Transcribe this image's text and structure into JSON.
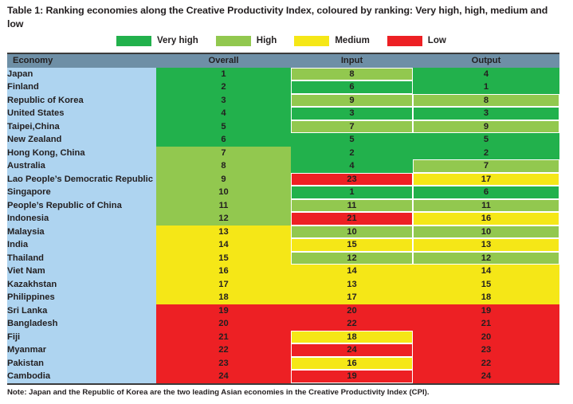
{
  "title": "Table 1: Ranking economies along the Creative Productivity Index, coloured by ranking: Very high, high, medium and low",
  "note": "Note: Japan and the Republic of Korea are the two leading Asian economies in the Creative Productivity Index (CPI).",
  "colors": {
    "very_high": "#22b14c",
    "high": "#92c84f",
    "medium": "#f5e717",
    "low": "#ed2024",
    "header_bg": "#6e8fa6",
    "economy_bg": "#aed4f0",
    "rule": "#3b3b3b",
    "text": "#231f20"
  },
  "legend": {
    "items": [
      {
        "label": "Very high",
        "tier": "very_high"
      },
      {
        "label": "High",
        "tier": "high"
      },
      {
        "label": "Medium",
        "tier": "medium"
      },
      {
        "label": "Low",
        "tier": "low"
      }
    ]
  },
  "table": {
    "columns": [
      {
        "key": "economy",
        "label": "Economy",
        "align": "left"
      },
      {
        "key": "overall",
        "label": "Overall",
        "align": "center"
      },
      {
        "key": "input",
        "label": "Input",
        "align": "center"
      },
      {
        "key": "output",
        "label": "Output",
        "align": "center"
      }
    ],
    "rows": [
      {
        "economy": "Japan",
        "overall": 1,
        "overall_tier": "very_high",
        "input": 8,
        "input_tier": "high",
        "output": 4,
        "output_tier": "very_high"
      },
      {
        "economy": "Finland",
        "overall": 2,
        "overall_tier": "very_high",
        "input": 6,
        "input_tier": "very_high",
        "output": 1,
        "output_tier": "very_high"
      },
      {
        "economy": "Republic of Korea",
        "overall": 3,
        "overall_tier": "very_high",
        "input": 9,
        "input_tier": "high",
        "output": 8,
        "output_tier": "high"
      },
      {
        "economy": "United States",
        "overall": 4,
        "overall_tier": "very_high",
        "input": 3,
        "input_tier": "very_high",
        "output": 3,
        "output_tier": "very_high"
      },
      {
        "economy": "Taipei,China",
        "overall": 5,
        "overall_tier": "very_high",
        "input": 7,
        "input_tier": "high",
        "output": 9,
        "output_tier": "high"
      },
      {
        "economy": "New Zealand",
        "overall": 6,
        "overall_tier": "very_high",
        "input": 5,
        "input_tier": "very_high",
        "output": 5,
        "output_tier": "very_high"
      },
      {
        "economy": "Hong Kong, China",
        "overall": 7,
        "overall_tier": "high",
        "input": 2,
        "input_tier": "very_high",
        "output": 2,
        "output_tier": "very_high"
      },
      {
        "economy": "Australia",
        "overall": 8,
        "overall_tier": "high",
        "input": 4,
        "input_tier": "very_high",
        "output": 7,
        "output_tier": "high"
      },
      {
        "economy": "Lao People’s Democratic Republic",
        "overall": 9,
        "overall_tier": "high",
        "input": 23,
        "input_tier": "low",
        "output": 17,
        "output_tier": "medium"
      },
      {
        "economy": "Singapore",
        "overall": 10,
        "overall_tier": "high",
        "input": 1,
        "input_tier": "very_high",
        "output": 6,
        "output_tier": "very_high"
      },
      {
        "economy": "People’s Republic of China",
        "overall": 11,
        "overall_tier": "high",
        "input": 11,
        "input_tier": "high",
        "output": 11,
        "output_tier": "high"
      },
      {
        "economy": "Indonesia",
        "overall": 12,
        "overall_tier": "high",
        "input": 21,
        "input_tier": "low",
        "output": 16,
        "output_tier": "medium"
      },
      {
        "economy": "Malaysia",
        "overall": 13,
        "overall_tier": "medium",
        "input": 10,
        "input_tier": "high",
        "output": 10,
        "output_tier": "high"
      },
      {
        "economy": "India",
        "overall": 14,
        "overall_tier": "medium",
        "input": 15,
        "input_tier": "medium",
        "output": 13,
        "output_tier": "medium"
      },
      {
        "economy": "Thailand",
        "overall": 15,
        "overall_tier": "medium",
        "input": 12,
        "input_tier": "high",
        "output": 12,
        "output_tier": "high"
      },
      {
        "economy": "Viet Nam",
        "overall": 16,
        "overall_tier": "medium",
        "input": 14,
        "input_tier": "medium",
        "output": 14,
        "output_tier": "medium"
      },
      {
        "economy": "Kazakhstan",
        "overall": 17,
        "overall_tier": "medium",
        "input": 13,
        "input_tier": "medium",
        "output": 15,
        "output_tier": "medium"
      },
      {
        "economy": "Philippines",
        "overall": 18,
        "overall_tier": "medium",
        "input": 17,
        "input_tier": "medium",
        "output": 18,
        "output_tier": "medium"
      },
      {
        "economy": "Sri Lanka",
        "overall": 19,
        "overall_tier": "low",
        "input": 20,
        "input_tier": "low",
        "output": 19,
        "output_tier": "low"
      },
      {
        "economy": "Bangladesh",
        "overall": 20,
        "overall_tier": "low",
        "input": 22,
        "input_tier": "low",
        "output": 21,
        "output_tier": "low"
      },
      {
        "economy": "Fiji",
        "overall": 21,
        "overall_tier": "low",
        "input": 18,
        "input_tier": "medium",
        "output": 20,
        "output_tier": "low"
      },
      {
        "economy": "Myanmar",
        "overall": 22,
        "overall_tier": "low",
        "input": 24,
        "input_tier": "low",
        "output": 23,
        "output_tier": "low"
      },
      {
        "economy": "Pakistan",
        "overall": 23,
        "overall_tier": "low",
        "input": 16,
        "input_tier": "medium",
        "output": 22,
        "output_tier": "low"
      },
      {
        "economy": "Cambodia",
        "overall": 24,
        "overall_tier": "low",
        "input": 19,
        "input_tier": "low",
        "output": 24,
        "output_tier": "low"
      }
    ]
  }
}
